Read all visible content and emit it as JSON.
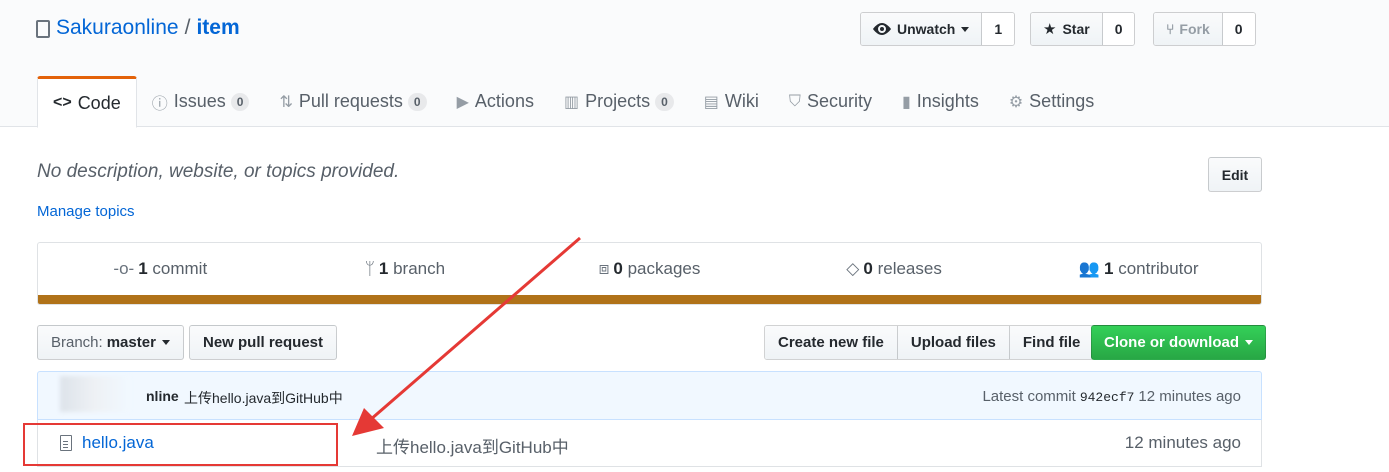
{
  "repo": {
    "owner": "Sakuraonline",
    "separator": "/",
    "name": "item"
  },
  "actions": {
    "unwatch_label": "Unwatch",
    "unwatch_count": "1",
    "star_label": "Star",
    "star_count": "0",
    "fork_label": "Fork",
    "fork_count": "0"
  },
  "tabs": [
    {
      "label": "Code",
      "icon": "code-icon"
    },
    {
      "label": "Issues",
      "count": "0",
      "icon": "issue-icon"
    },
    {
      "label": "Pull requests",
      "count": "0",
      "icon": "pull-request-icon"
    },
    {
      "label": "Actions",
      "icon": "play-icon"
    },
    {
      "label": "Projects",
      "count": "0",
      "icon": "project-icon"
    },
    {
      "label": "Wiki",
      "icon": "book-icon"
    },
    {
      "label": "Security",
      "icon": "shield-icon"
    },
    {
      "label": "Insights",
      "icon": "graph-icon"
    },
    {
      "label": "Settings",
      "icon": "gear-icon"
    }
  ],
  "about": {
    "description": "No description, website, or topics provided.",
    "manage_topics": "Manage topics",
    "edit_label": "Edit"
  },
  "numbers": [
    {
      "value": "1",
      "label": "commit"
    },
    {
      "value": "1",
      "label": "branch"
    },
    {
      "value": "0",
      "label": "packages"
    },
    {
      "value": "0",
      "label": "releases"
    },
    {
      "value": "1",
      "label": "contributor"
    }
  ],
  "lang_color": "#b07219",
  "toolbar": {
    "branch_prefix": "Branch:",
    "branch_name": "master",
    "new_pr": "New pull request",
    "create_file": "Create new file",
    "upload_files": "Upload files",
    "find_file": "Find file",
    "clone": "Clone or download"
  },
  "commit": {
    "author": "nline",
    "message": "上传hello.java到GitHub中",
    "latest_prefix": "Latest commit",
    "sha": "942ecf7",
    "age": "12 minutes ago"
  },
  "files": [
    {
      "name": "hello.java",
      "message": "上传hello.java到GitHub中",
      "age": "12 minutes ago"
    }
  ]
}
